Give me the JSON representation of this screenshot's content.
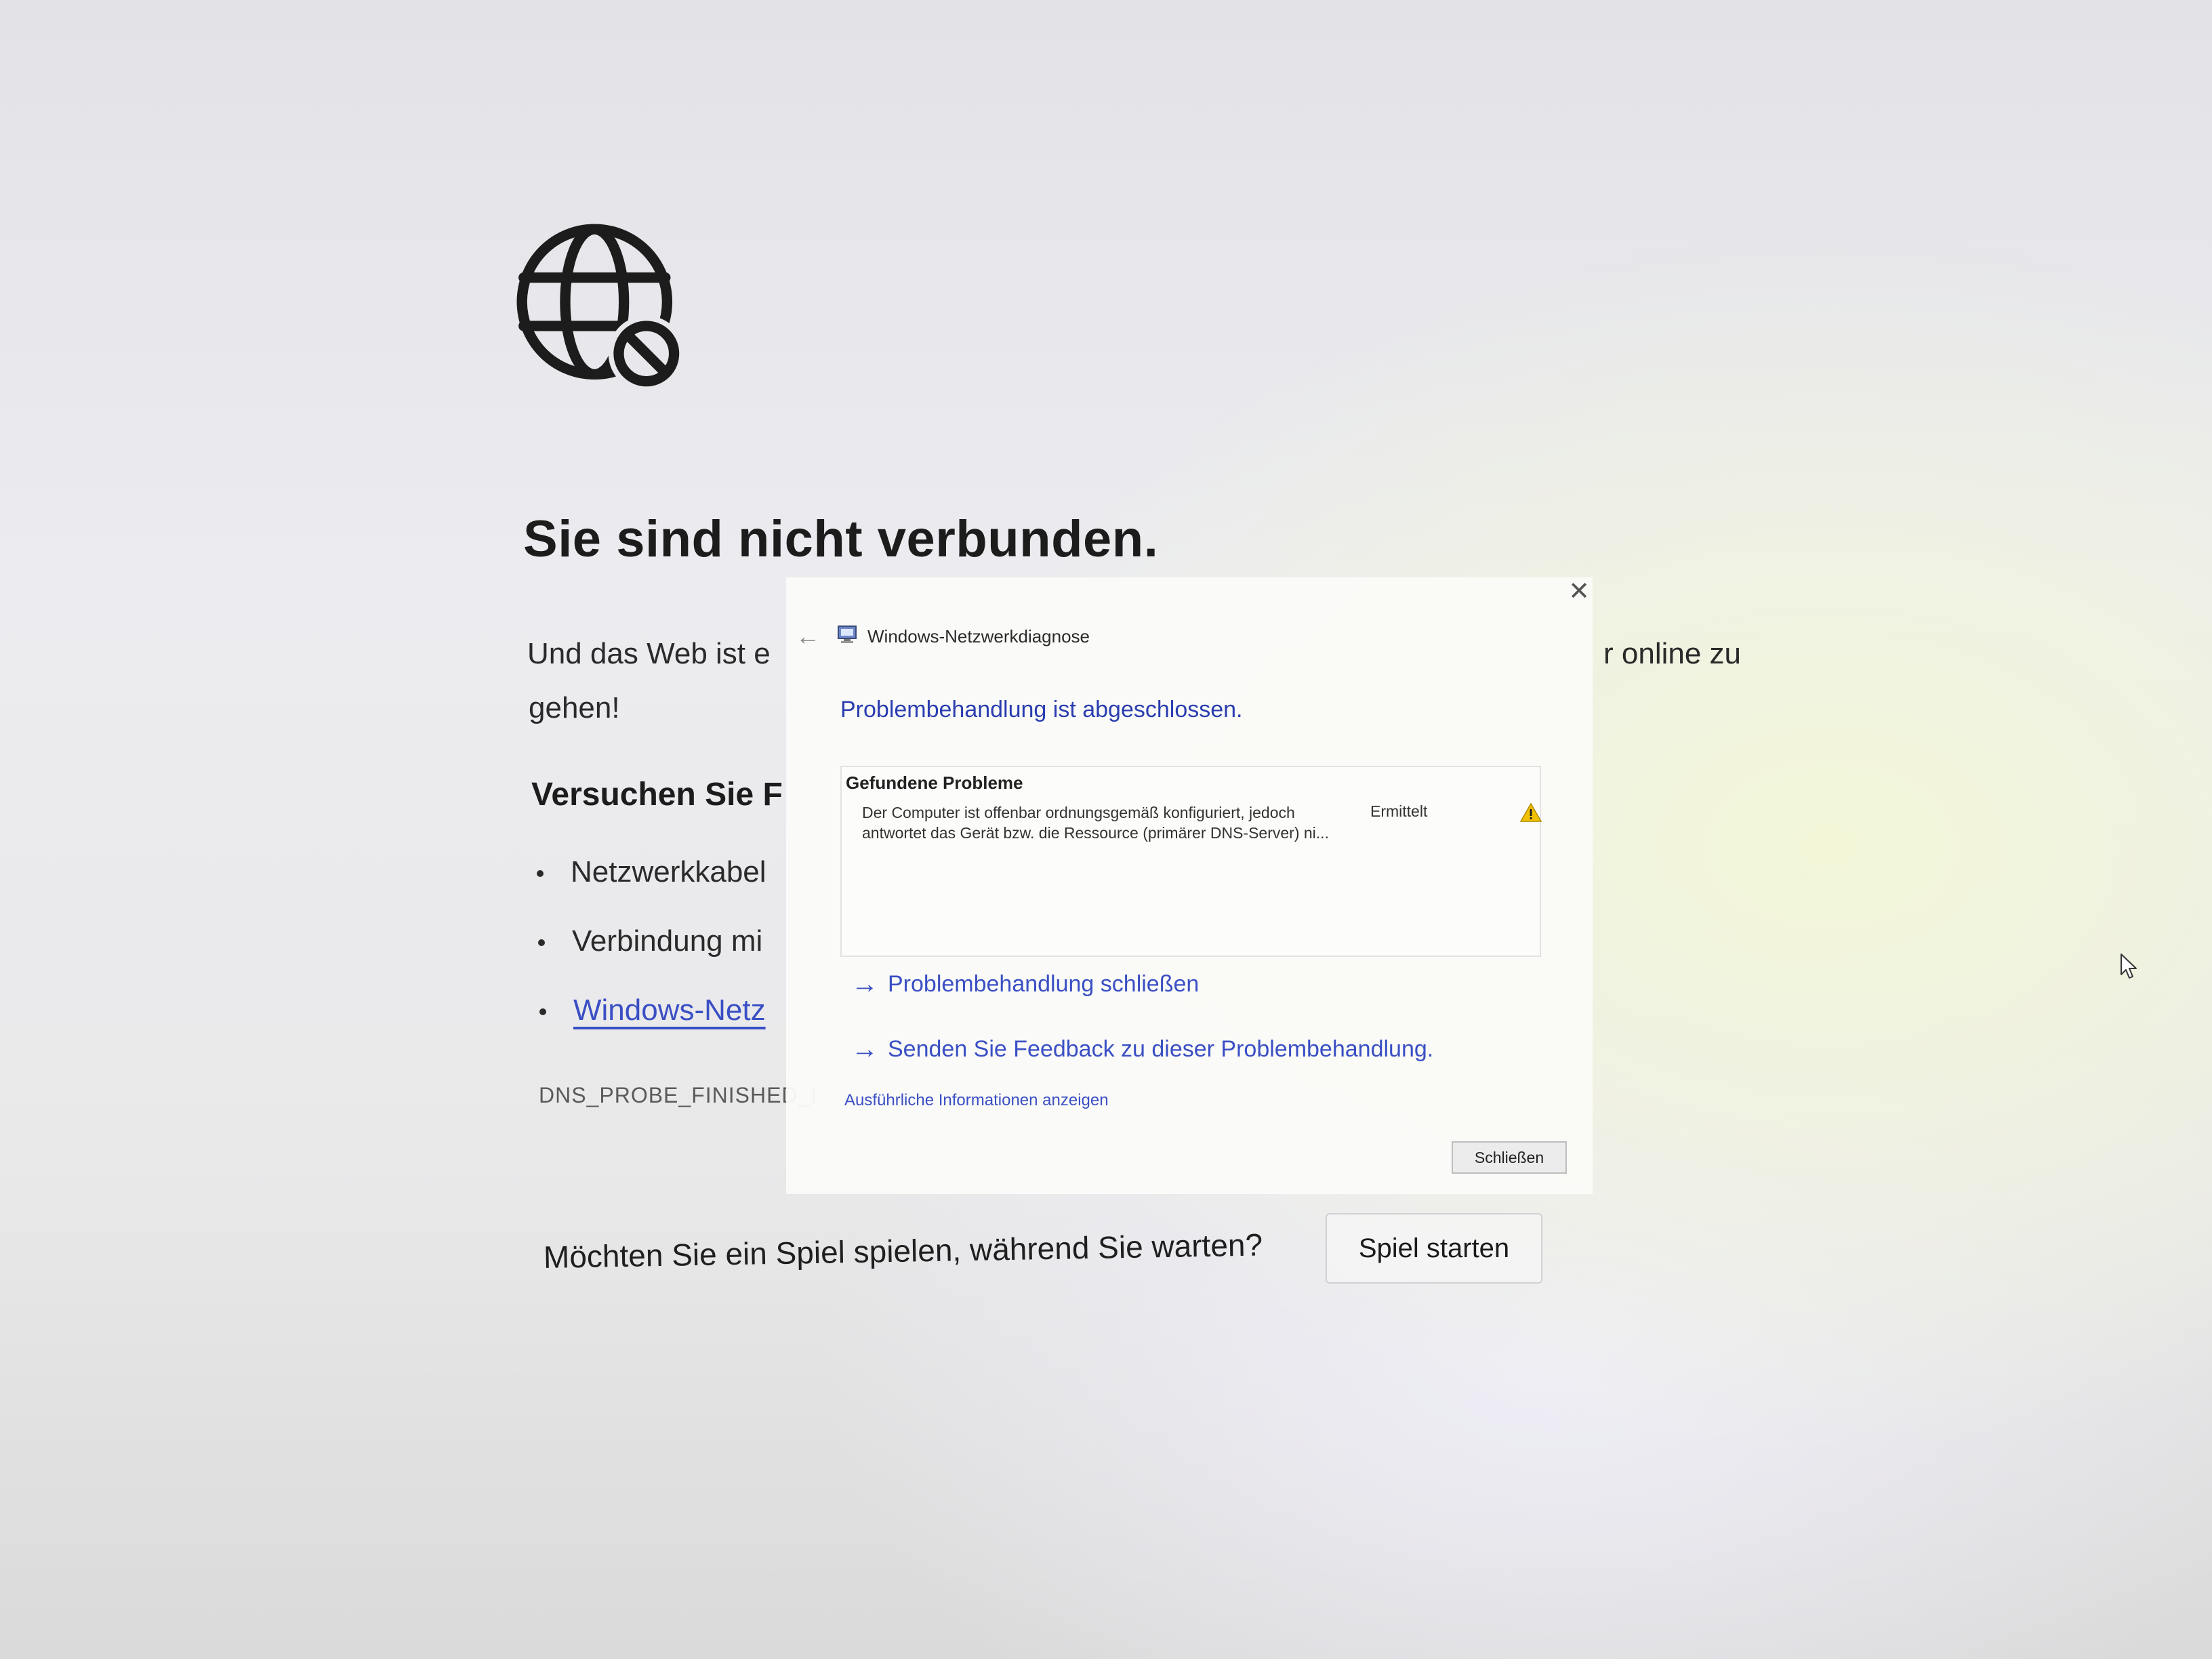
{
  "offline_page": {
    "title": "Sie sind nicht verbunden.",
    "paragraph_line1_visible": "Und das Web ist e",
    "paragraph_line1_tail": "r online zu",
    "paragraph_line2": "gehen!",
    "try_title": "Versuchen Sie F",
    "bullets": [
      "Netzwerkkabel",
      "Verbindung mi",
      "Windows-Netz"
    ],
    "error_code": "DNS_PROBE_FINISHED_I",
    "game_question": "Möchten Sie ein Spiel spielen, während Sie warten?",
    "game_button_label": "Spiel starten"
  },
  "dialog": {
    "close_glyph": "✕",
    "back_glyph": "←",
    "title": "Windows-Netzwerkdiagnose",
    "status": "Problembehandlung ist abgeschlossen.",
    "problems_heading": "Gefundene Probleme",
    "problem_description": "Der Computer ist offenbar ordnungsgemäß konfiguriert, jedoch antwortet das Gerät bzw. die Ressource (primärer DNS-Server) ni...",
    "problem_status": "Ermittelt",
    "link_close_troubleshoot": "Problembehandlung schließen",
    "link_feedback": "Senden Sie Feedback zu dieser Problembehandlung.",
    "link_details": "Ausführliche Informationen anzeigen",
    "close_button_label": "Schließen",
    "link_arrow_glyph": "→"
  },
  "icons": {
    "globe": "globe-blocked-icon",
    "warning": "warning-icon",
    "app": "network-diagnostics-icon",
    "cursor": "mouse-cursor"
  },
  "colors": {
    "link": "#3a4fc4",
    "status_text": "#2a3db0",
    "warning": "#f2c200"
  }
}
